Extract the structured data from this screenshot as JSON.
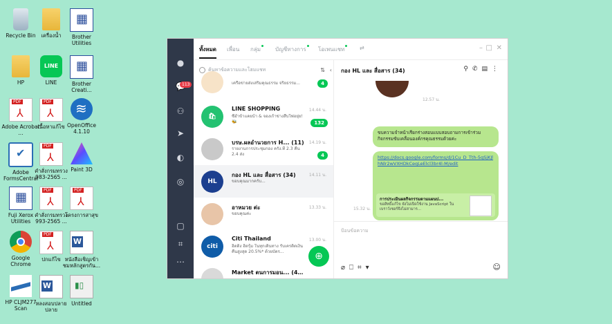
{
  "desktop": {
    "icons": [
      {
        "label": "Recycle Bin",
        "type": "bin"
      },
      {
        "label": "เครื่องน้ำ",
        "type": "folder"
      },
      {
        "label": "Brother Utilities",
        "type": "brother"
      },
      {
        "label": "HP",
        "type": "folder"
      },
      {
        "label": "LINE",
        "type": "line"
      },
      {
        "label": "Brother Creati...",
        "type": "brother"
      },
      {
        "label": "Adobe Acrobat ...",
        "type": "pdf"
      },
      {
        "label": "เนื้อหาแก้ไข",
        "type": "pdf"
      },
      {
        "label": "OpenOffice 4.1.10",
        "type": "openoffice"
      },
      {
        "label": "Adobe FormsCentral",
        "type": "forms"
      },
      {
        "label": "คำสั่งกรมทรวง 983-2565 ...",
        "type": "pdf"
      },
      {
        "label": "Paint 3D",
        "type": "paint3d"
      },
      {
        "label": "Fuji Xerox Utilities",
        "type": "fuji"
      },
      {
        "label": "คำสั่งกรมทรวง 993-2565 ...",
        "type": "pdf"
      },
      {
        "label": "โครงการสาสุข",
        "type": "pdf"
      },
      {
        "label": "Google Chrome",
        "type": "chrome"
      },
      {
        "label": "ปกแก้ไข",
        "type": "pdf"
      },
      {
        "label": "หนังสือเชิญเข้าชมหลักสูตรกัน...",
        "type": "word"
      },
      {
        "label": "HP CLJM277 Scan",
        "type": "scan"
      },
      {
        "label": "หลงสอบปลายปลาย",
        "type": "word"
      },
      {
        "label": "Untitled",
        "type": "untitled"
      }
    ]
  },
  "line": {
    "tabs": [
      {
        "label": "ทั้งหมด",
        "active": true,
        "dot": false
      },
      {
        "label": "เพื่อน",
        "active": false,
        "dot": false
      },
      {
        "label": "กลุ่ม",
        "active": false,
        "dot": true
      },
      {
        "label": "บัญชีทางการ",
        "active": false,
        "dot": true
      },
      {
        "label": "โอเพนแชท",
        "active": false,
        "dot": true
      }
    ],
    "rail_badge": "113",
    "search_placeholder": "ค้นหาข้อความและโฮมแชท",
    "chats": [
      {
        "name": "",
        "preview": "เครือข่ายส่งเสริมคุณธรรม จริยธรรม...",
        "time": "",
        "count": "4",
        "avatar_color": "#f7e3c8",
        "avatar_text": "",
        "selected": false
      },
      {
        "name": "LINE SHOPPING",
        "preview": "ซื้อ้ำข้าแคยบ้า & จองเก้าข่างสืบใฟอยุ่ย! 🐝",
        "time": "14.44 น.",
        "count": "132",
        "avatar_color": "#23c271",
        "avatar_text": "🛍",
        "selected": false
      },
      {
        "name": "บรษ.ผลอำนวยการ H... (11)",
        "preview": "รายงานการประชุมกอง ครั้ง.ที่ 2.3 คืน 2.4 ส่ง",
        "time": "14.19 น.",
        "count": "4",
        "avatar_color": "#c9c9c9",
        "avatar_text": "",
        "selected": false
      },
      {
        "name": "กอง HL และ สื่อสาร (34)",
        "preview": "ขอบคุณมากครับ...",
        "time": "14.11 น.",
        "count": "",
        "avatar_color": "#1c3f8f",
        "avatar_text": "HL",
        "selected": true
      },
      {
        "name": "อาหมวย ต่ะ",
        "preview": "ขอบคุณค่ะ",
        "time": "13.33 น.",
        "count": "",
        "avatar_color": "#e8c5a8",
        "avatar_text": "",
        "selected": false
      },
      {
        "name": "Citi Thailand",
        "preview": "ฮิตติ้ง ฮิตรุ้ม ในทุกเดินทาง รับเครดิตเงินคืนสูงสุด 20.5%* ด้วยบัตร...",
        "time": "13.00 น.",
        "count": "",
        "avatar_color": "#0f5ca8",
        "avatar_text": "citi",
        "selected": false
      },
      {
        "name": "Market ตนการมอน... (402)",
        "preview": "",
        "time": "",
        "count": "",
        "avatar_color": "#d9d9d9",
        "avatar_text": "",
        "selected": false
      }
    ],
    "conversation": {
      "title": "กอง HL และ สื่อสาร (34)",
      "sticker_time": "12.57 น.",
      "message1": "ขบความจำหน้าเรียกร่างสอบแบบสอบถามการเข้าร่วมกิจกรรมขับเคลื่อนองค์กรคุณธรรมด้วยค่ะ",
      "link": "https://docs.google.com/forms/d/1Cu_D_Tth-5qSjKJlhNlr2wVXHDkCeqLeElcl3br4l-M/edit",
      "preview_title": "การประเมินผลกิจกรรมตามแผนป...",
      "preview_desc": "ขอสิทธิ์แก้ไข ยังไม่เปิดใช้งาน JavaScript ในเบราว์เซอร์จึงไม่สามาร...",
      "message_time": "15.32 น.",
      "compose_placeholder": "ป้อนข้อความ"
    }
  }
}
